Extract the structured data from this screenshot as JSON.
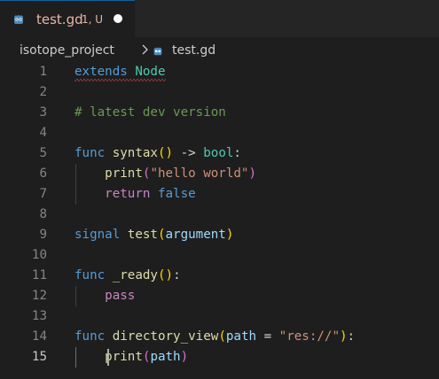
{
  "tab": {
    "title": "test.gd",
    "status": "1, U",
    "icon": "godot-icon"
  },
  "breadcrumb": {
    "project": "isotope_project",
    "file": "test.gd"
  },
  "lines": [
    {
      "n": "1",
      "tokens": [
        {
          "t": "extends",
          "c": "kw"
        },
        {
          "t": " ",
          "c": "pn"
        },
        {
          "t": "Node",
          "c": "ty"
        }
      ]
    },
    {
      "n": "2",
      "tokens": []
    },
    {
      "n": "3",
      "tokens": [
        {
          "t": "# latest dev version",
          "c": "cm"
        }
      ]
    },
    {
      "n": "4",
      "tokens": []
    },
    {
      "n": "5",
      "tokens": [
        {
          "t": "func",
          "c": "kw"
        },
        {
          "t": " ",
          "c": "pn"
        },
        {
          "t": "syntax",
          "c": "fn"
        },
        {
          "t": "()",
          "c": "br"
        },
        {
          "t": " -> ",
          "c": "pn"
        },
        {
          "t": "bool",
          "c": "ty"
        },
        {
          "t": ":",
          "c": "pn"
        }
      ]
    },
    {
      "n": "6",
      "tokens": [
        {
          "t": "    ",
          "c": "pn"
        },
        {
          "t": "print",
          "c": "fn"
        },
        {
          "t": "(",
          "c": "br2"
        },
        {
          "t": "\"hello world\"",
          "c": "st"
        },
        {
          "t": ")",
          "c": "br2"
        }
      ]
    },
    {
      "n": "7",
      "tokens": [
        {
          "t": "    ",
          "c": "pn"
        },
        {
          "t": "return",
          "c": "ctl"
        },
        {
          "t": " ",
          "c": "pn"
        },
        {
          "t": "false",
          "c": "kw"
        }
      ]
    },
    {
      "n": "8",
      "tokens": []
    },
    {
      "n": "9",
      "tokens": [
        {
          "t": "signal",
          "c": "kw"
        },
        {
          "t": " ",
          "c": "pn"
        },
        {
          "t": "test",
          "c": "fn"
        },
        {
          "t": "(",
          "c": "br"
        },
        {
          "t": "argument",
          "c": "vr"
        },
        {
          "t": ")",
          "c": "br"
        }
      ]
    },
    {
      "n": "10",
      "tokens": []
    },
    {
      "n": "11",
      "tokens": [
        {
          "t": "func",
          "c": "kw"
        },
        {
          "t": " ",
          "c": "pn"
        },
        {
          "t": "_ready",
          "c": "fn"
        },
        {
          "t": "()",
          "c": "br"
        },
        {
          "t": ":",
          "c": "pn"
        }
      ]
    },
    {
      "n": "12",
      "tokens": [
        {
          "t": "    ",
          "c": "pn"
        },
        {
          "t": "pass",
          "c": "ctl"
        }
      ]
    },
    {
      "n": "13",
      "tokens": []
    },
    {
      "n": "14",
      "tokens": [
        {
          "t": "func",
          "c": "kw"
        },
        {
          "t": " ",
          "c": "pn"
        },
        {
          "t": "directory_view",
          "c": "fn"
        },
        {
          "t": "(",
          "c": "br"
        },
        {
          "t": "path",
          "c": "vr"
        },
        {
          "t": " = ",
          "c": "pn"
        },
        {
          "t": "\"res://\"",
          "c": "st"
        },
        {
          "t": ")",
          "c": "br"
        },
        {
          "t": ":",
          "c": "pn"
        }
      ]
    },
    {
      "n": "15",
      "tokens": [
        {
          "t": "    ",
          "c": "pn"
        },
        {
          "t": "print",
          "c": "fn"
        },
        {
          "t": "(",
          "c": "br2"
        },
        {
          "t": "path",
          "c": "vr"
        },
        {
          "t": ")",
          "c": "br2"
        }
      ]
    }
  ],
  "active_line": "15",
  "error_line": "1",
  "colors": {
    "background": "#1e1e1e",
    "tab_accent": "#0e639c",
    "tab_text_modified": "#e7b6a6",
    "error_squiggle": "#f14c4c"
  }
}
